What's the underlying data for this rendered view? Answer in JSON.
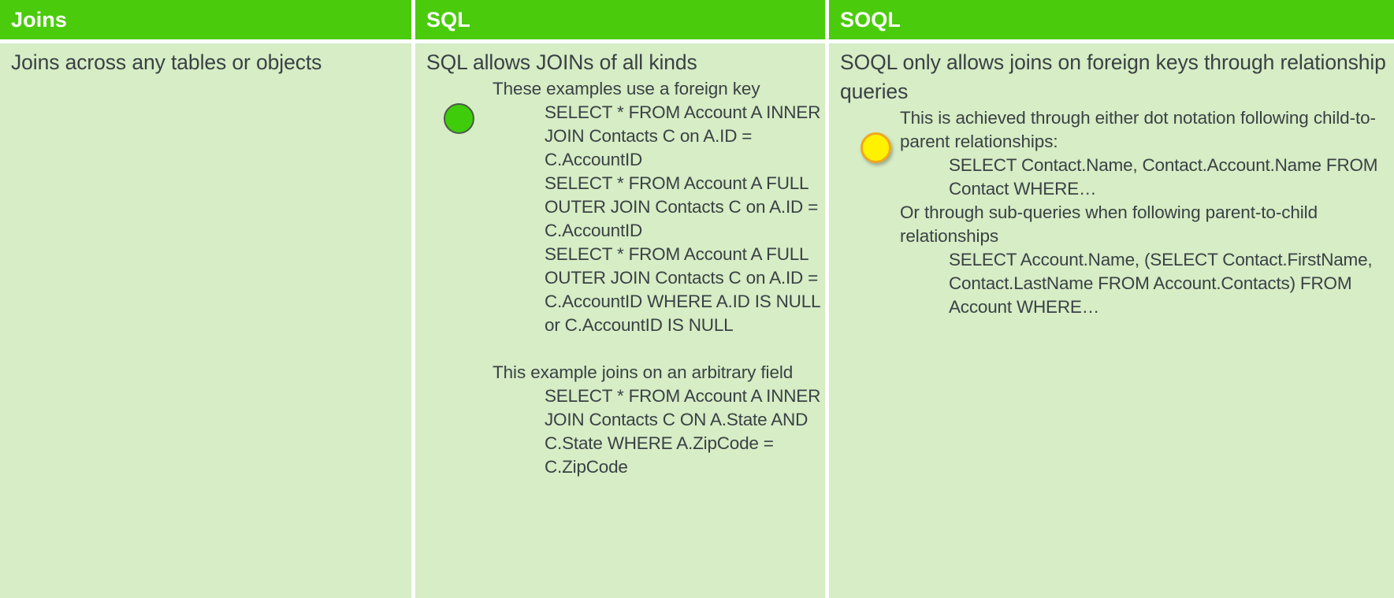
{
  "table": {
    "columns": [
      {
        "id": "joins",
        "header": "Joins"
      },
      {
        "id": "sql",
        "header": "SQL"
      },
      {
        "id": "soql",
        "header": "SOQL"
      }
    ],
    "colors": {
      "header_background": "#4ACC0D",
      "header_text": "#FFFFFF",
      "cell_background": "#D6EDC5",
      "cell_text": "#3A4145",
      "bullet_green": "#3FCC0B",
      "bullet_yellow": "#FFF200",
      "bullet_yellow_border": "#F0A81E"
    }
  },
  "joins": {
    "lead": "Joins across any tables or objects"
  },
  "sql": {
    "lead": "SQL allows JOINs of all kinds",
    "bullet_icon": "green-circle-bullet",
    "note_1": "These examples use a foreign key",
    "code_1": "SELECT * FROM Account A INNER JOIN Contacts C on A.ID = C.AccountID",
    "code_2": "SELECT * FROM Account A FULL OUTER JOIN Contacts C on A.ID = C.AccountID",
    "code_3": "SELECT * FROM Account A FULL OUTER JOIN Contacts C on A.ID = C.AccountID WHERE A.ID IS NULL or C.AccountID IS NULL",
    "note_2": "This example joins on an arbitrary field",
    "code_4": "SELECT * FROM Account A INNER JOIN Contacts C ON A.State AND C.State WHERE A.ZipCode = C.ZipCode"
  },
  "soql": {
    "lead": "SOQL only allows joins on foreign keys through relationship queries",
    "bullet_icon": "yellow-circle-bullet",
    "note_1": "This is achieved through either dot notation following child-to-parent relationships:",
    "code_1": "SELECT Contact.Name, Contact.Account.Name FROM Contact WHERE…",
    "note_2": "Or through sub-queries when following parent-to-child relationships",
    "code_2": "SELECT Account.Name, (SELECT Contact.FirstName, Contact.LastName FROM Account.Contacts) FROM Account WHERE…"
  }
}
